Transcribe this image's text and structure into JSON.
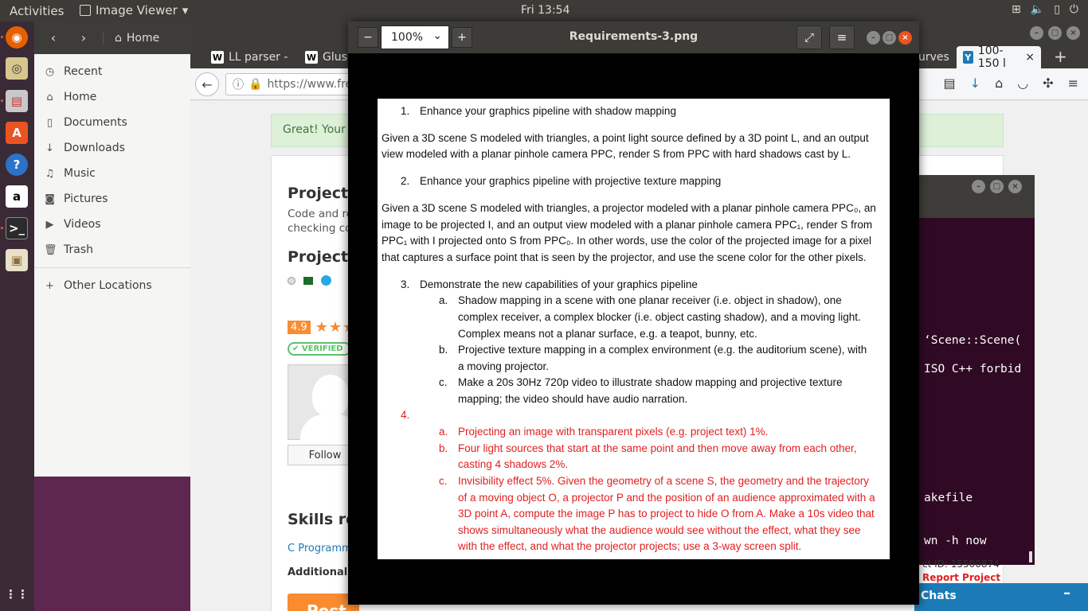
{
  "topbar": {
    "activities": "Activities",
    "app_name": "Image Viewer",
    "clock": "Fri 13:54"
  },
  "files": {
    "home_crumb": "Home",
    "places": [
      {
        "label": "Recent",
        "icon": "clock-icon"
      },
      {
        "label": "Home",
        "icon": "home-icon"
      },
      {
        "label": "Documents",
        "icon": "document-icon"
      },
      {
        "label": "Downloads",
        "icon": "download-icon"
      },
      {
        "label": "Music",
        "icon": "music-icon"
      },
      {
        "label": "Pictures",
        "icon": "camera-icon"
      },
      {
        "label": "Videos",
        "icon": "video-icon"
      },
      {
        "label": "Trash",
        "icon": "trash-icon"
      }
    ],
    "other_locations": "Other Locations"
  },
  "firefox": {
    "tabs": [
      {
        "label": "LL parser -"
      },
      {
        "label": "Glush"
      },
      {
        "label": "urves"
      },
      {
        "label": "100-150 l"
      }
    ],
    "url": "https://www.free",
    "alert": "Great! Your b",
    "project_title": "Project D",
    "project_desc_1": "Code and re",
    "project_desc_2": "checking co",
    "project_section": "Project p",
    "rating": "4.9",
    "verified": "VERIFIED",
    "follow": "Follow",
    "skills_title": "Skills re",
    "skill_link": "C Programmi",
    "additional_files": "Additional File",
    "post_button": "Post a",
    "behind_id": "ct ID: 15500874",
    "report_project": "Report Project",
    "chats": "Chats"
  },
  "terminal": {
    "lines": [
      "‘Scene::Scene(",
      "ISO C++ forbid",
      "akefile",
      "wn -h now"
    ]
  },
  "viewer": {
    "zoom": "100%",
    "title": "Requirements-3.png"
  },
  "doc": {
    "item1_num": "1.",
    "item1": "Enhance your graphics pipeline with shadow mapping",
    "para1_l1": "Given a 3D scene S modeled with triangles, a point light source defined by a 3D point L, and an output",
    "para1_l2": "view modeled with a planar pinhole camera PPC, render S from PPC with hard shadows cast by L.",
    "item2_num": "2.",
    "item2": "Enhance your graphics pipeline with projective texture mapping",
    "para2_l1": "Given a 3D scene S modeled with triangles, a projector modeled with a planar pinhole camera PPC₀, an",
    "para2_l2": "image to be projected I, and an output view modeled with a planar pinhole camera PPC₁, render S from",
    "para2_l3": "PPC₁ with I projected onto S from PPC₀. In other words, use the color of the projected image for a pixel",
    "para2_l4": "that captures a surface point that is seen by the projector, and use the scene color for the other pixels.",
    "item3_num": "3.",
    "item3": "Demonstrate the new capabilities of your graphics pipeline",
    "a3_label": "a.",
    "a3_l1": "Shadow mapping in a scene with one planar receiver (i.e. object in shadow), one",
    "a3_l2": "complex receiver, a complex blocker (i.e. object casting shadow), and a moving light.",
    "a3_l3": "Complex means not a planar surface, e.g. a teapot, bunny, etc.",
    "b3_label": "b.",
    "b3_l1": "Projective texture mapping in a complex environment (e.g. the auditorium scene), with",
    "b3_l2": "a moving projector.",
    "c3_label": "c.",
    "c3_l1": "Make a 20s 30Hz 720p video to illustrate shadow mapping and projective texture",
    "c3_l2": "mapping; the video should have audio narration.",
    "item4_num": "4.",
    "a4_label": "a.",
    "a4_l1": "Projecting an image with transparent pixels (e.g. project text) 1%.",
    "b4_label": "b.",
    "b4_l1": "Four light sources that start at the same point and then move away from each other,",
    "b4_l2": "casting 4 shadows 2%.",
    "c4_label": "c.",
    "c4_l1": "Invisibility effect 5%. Given the geometry of a scene S, the geometry and the trajectory",
    "c4_l2": "of a moving object O, a projector P and the position of an audience approximated with a",
    "c4_l3": "3D point A, compute the image P has to project to hide O from A. Make a 10s video that",
    "c4_l4": "shows simultaneously what the audience would see without the effect, what they see",
    "c4_l5": "with the effect, and what the projector projects; use a 3-way screen split."
  }
}
